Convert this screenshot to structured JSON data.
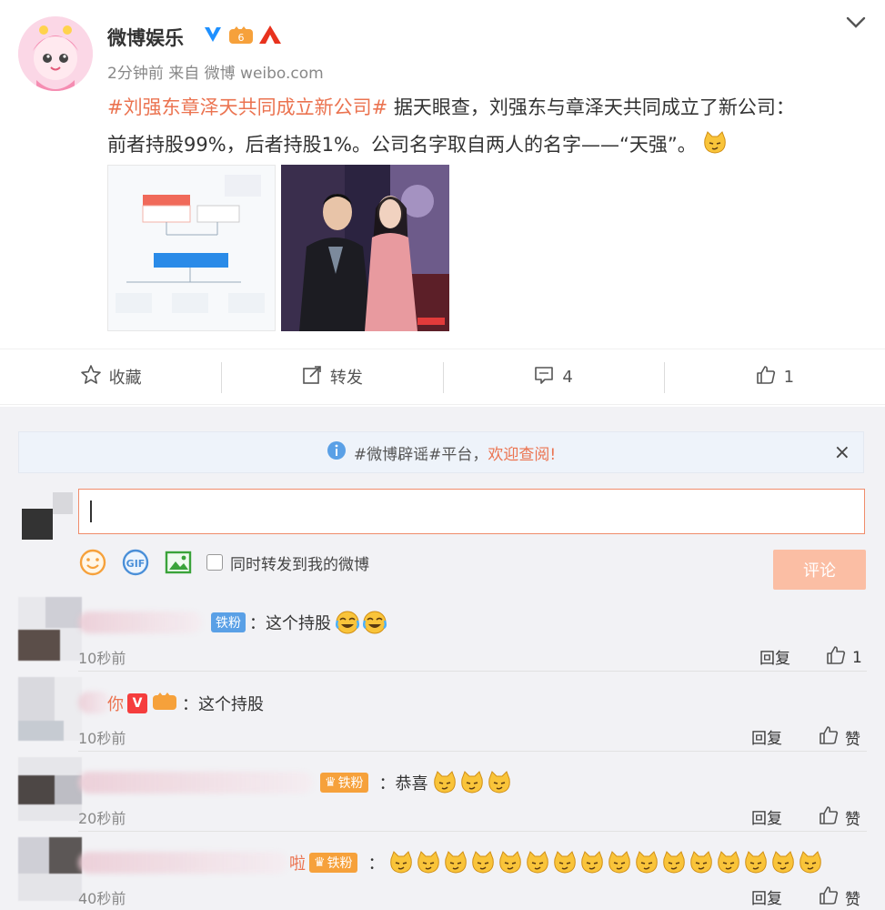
{
  "post": {
    "author": "微博娱乐",
    "time": "2分钟前",
    "source_prefix": "来自",
    "source": "微博 weibo.com",
    "hashtag": "#刘强东章泽天共同成立新公司#",
    "text_line1_rest": " 据天眼查，刘强东与章泽天共同成立了新公司：",
    "text_line2": "前者持股99%，后者持股1%。公司名字取自两人的名字——“天强”。"
  },
  "actions": {
    "favorite_label": "收藏",
    "repost_label": "转发",
    "comment_count": "4",
    "like_count": "1"
  },
  "notice": {
    "prefix": "#微博辟谣#平台，",
    "highlight": "欢迎查阅!"
  },
  "composer": {
    "checkbox_label": "同时转发到我的微博",
    "submit_label": "评论"
  },
  "comments": [
    {
      "tag": "铁粉",
      "text": "：这个持股",
      "time": "10秒前",
      "reply": "回复",
      "like": "1"
    },
    {
      "name_tail": "你",
      "text": "：这个持股",
      "time": "10秒前",
      "reply": "回复",
      "like": "赞"
    },
    {
      "tag": "铁粉",
      "text": "：恭喜",
      "time": "20秒前",
      "reply": "回复",
      "like": "赞"
    },
    {
      "name_tail": "啦",
      "tag": "铁粉",
      "text": "：",
      "time": "40秒前",
      "reply": "回复",
      "like": "赞"
    }
  ],
  "colors": {
    "hashtag": "#eb7350",
    "accent": "#f08c6b",
    "submit_bg": "#fbbea4",
    "comments_bg": "#f2f2f5"
  },
  "icons": [
    "chevron-down-icon",
    "verified-v-icon",
    "level-crown-icon",
    "live-a-icon",
    "star-icon",
    "repost-icon",
    "comment-icon",
    "like-icon",
    "info-icon",
    "close-icon",
    "smile-icon",
    "gif-icon",
    "image-icon",
    "cat-emoji-icon",
    "laugh-cry-emoji-icon"
  ]
}
